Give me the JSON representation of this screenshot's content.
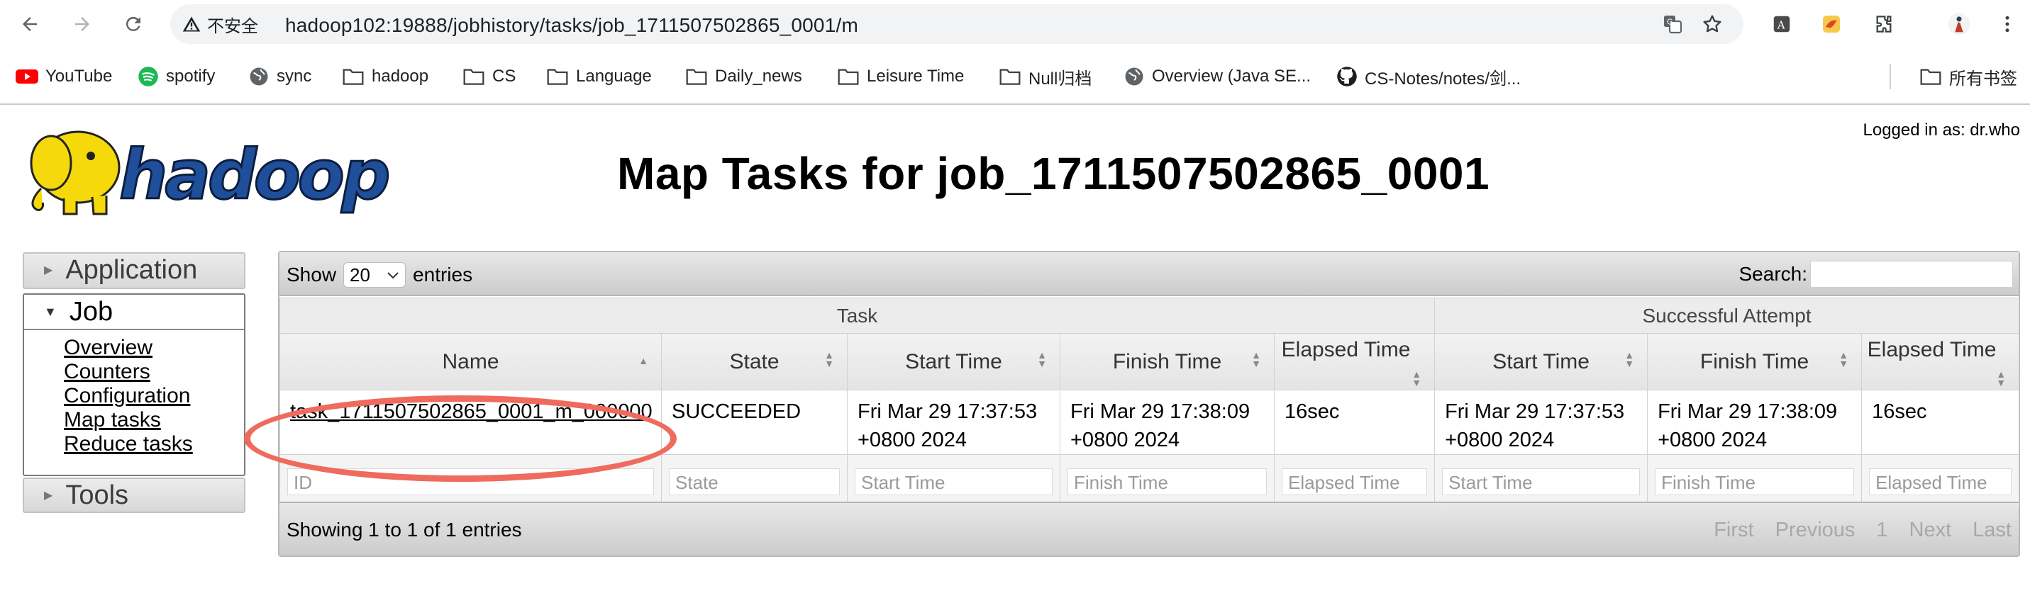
{
  "browser": {
    "security_label": "不安全",
    "url": "hadoop102:19888/jobhistory/tasks/job_1711507502865_0001/m",
    "bookmarks": [
      {
        "label": "YouTube",
        "icon": "youtube-icon"
      },
      {
        "label": "spotify",
        "icon": "spotify-icon"
      },
      {
        "label": "sync",
        "icon": "globe-icon"
      },
      {
        "label": "hadoop",
        "icon": "folder-icon"
      },
      {
        "label": "CS",
        "icon": "folder-icon"
      },
      {
        "label": "Language",
        "icon": "folder-icon"
      },
      {
        "label": "Daily_news",
        "icon": "folder-icon"
      },
      {
        "label": "Leisure Time",
        "icon": "folder-icon"
      },
      {
        "label": "Null归档",
        "icon": "folder-icon"
      },
      {
        "label": "Overview (Java SE...",
        "icon": "globe-icon"
      },
      {
        "label": "CS-Notes/notes/剑...",
        "icon": "github-icon"
      }
    ],
    "all_bookmarks_label": "所有书签"
  },
  "page": {
    "logo_text": "hadoop",
    "title": "Map Tasks for job_1711507502865_0001",
    "logged_in": "Logged in as: dr.who"
  },
  "sidebar": {
    "application": "Application",
    "job": "Job",
    "job_links": [
      "Overview",
      "Counters",
      "Configuration",
      "Map tasks",
      "Reduce tasks"
    ],
    "tools": "Tools"
  },
  "table": {
    "show_label": "Show",
    "entries_value": "20",
    "entries_label": "entries",
    "search_label": "Search:",
    "group_task": "Task",
    "group_attempt": "Successful Attempt",
    "columns": [
      "Name",
      "State",
      "Start Time",
      "Finish Time",
      "Elapsed Time",
      "Start Time",
      "Finish Time",
      "Elapsed Time"
    ],
    "rows": [
      {
        "name": "task_1711507502865_0001_m_000000",
        "state": "SUCCEEDED",
        "start_l1": "Fri Mar 29 17:37:53",
        "start_l2": "+0800 2024",
        "finish_l1": "Fri Mar 29 17:38:09",
        "finish_l2": "+0800 2024",
        "elapsed": "16sec",
        "att_start_l1": "Fri Mar 29 17:37:53",
        "att_start_l2": "+0800 2024",
        "att_finish_l1": "Fri Mar 29 17:38:09",
        "att_finish_l2": "+0800 2024",
        "att_elapsed": "16sec"
      }
    ],
    "filters": [
      "ID",
      "State",
      "Start Time",
      "Finish Time",
      "Elapsed Time",
      "Start Time",
      "Finish Time",
      "Elapsed Time"
    ],
    "showing": "Showing 1 to 1 of 1 entries",
    "pager": [
      "First",
      "Previous",
      "1",
      "Next",
      "Last"
    ]
  },
  "colors": {
    "annotation": "#ee6b5e",
    "logo_blue": "#1f4e9a",
    "logo_yellow": "#f5d90a"
  }
}
